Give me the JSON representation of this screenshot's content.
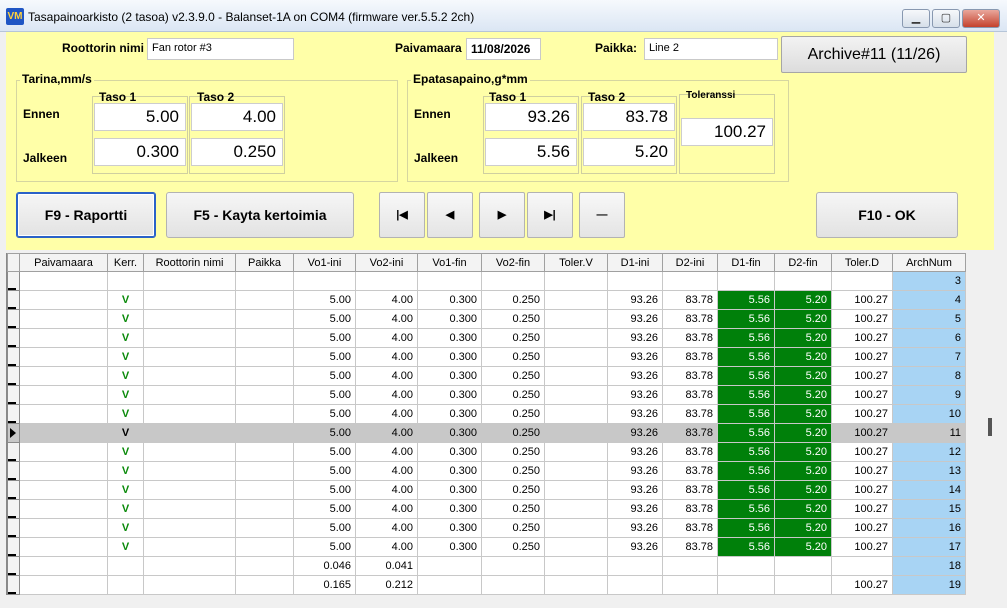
{
  "window": {
    "title": "Tasapainoarkisto (2 tasoa) v2.3.9.0 - Balanset-1A on COM4 (firmware ver.5.5.2 2ch)",
    "icon": "VM"
  },
  "header": {
    "rotor_label": "Roottorin nimi",
    "rotor_value": "Fan rotor #3",
    "date_label": "Paivamaara",
    "date_value": "11/08/2026",
    "place_label": "Paikka:",
    "place_value": "Line 2",
    "archive_button": "Archive#11 (11/26)"
  },
  "vibration": {
    "title": "Tarina,mm/s",
    "taso1": "Taso 1",
    "taso2": "Taso 2",
    "ennen": "Ennen",
    "jalkeen": "Jalkeen",
    "ennen_t1": "5.00",
    "ennen_t2": "4.00",
    "jalkeen_t1": "0.300",
    "jalkeen_t2": "0.250"
  },
  "imbalance": {
    "title": "Epatasapaino,g*mm",
    "taso1": "Taso 1",
    "taso2": "Taso 2",
    "toleranssi": "Toleranssi",
    "ennen": "Ennen",
    "jalkeen": "Jalkeen",
    "ennen_t1": "93.26",
    "ennen_t2": "83.78",
    "jalkeen_t1": "5.56",
    "jalkeen_t2": "5.20",
    "tolerance_value": "100.27"
  },
  "buttons": {
    "report": "F9 - Raportti",
    "coeffs": "F5 - Kayta kertoimia",
    "ok": "F10 - OK",
    "first": "|◀",
    "prev": "◀",
    "next": "▶",
    "last": "▶|",
    "delete": "—"
  },
  "grid": {
    "columns": [
      "Paivamaara",
      "Kerr.",
      "Roottorin nimi",
      "Paikka",
      "Vo1-ini",
      "Vo2-ini",
      "Vo1-fin",
      "Vo2-fin",
      "Toler.V",
      "D1-ini",
      "D2-ini",
      "D1-fin",
      "D2-fin",
      "Toler.D",
      "ArchNum"
    ],
    "rows": [
      {
        "kerr": "",
        "vo1i": "",
        "vo2i": "",
        "vo1f": "",
        "vo2f": "",
        "d1i": "",
        "d2i": "",
        "d1f": "",
        "d2f": "",
        "told": "",
        "arch": "3"
      },
      {
        "kerr": "V",
        "vo1i": "5.00",
        "vo2i": "4.00",
        "vo1f": "0.300",
        "vo2f": "0.250",
        "d1i": "93.26",
        "d2i": "83.78",
        "d1f": "5.56",
        "d2f": "5.20",
        "told": "100.27",
        "arch": "4"
      },
      {
        "kerr": "V",
        "vo1i": "5.00",
        "vo2i": "4.00",
        "vo1f": "0.300",
        "vo2f": "0.250",
        "d1i": "93.26",
        "d2i": "83.78",
        "d1f": "5.56",
        "d2f": "5.20",
        "told": "100.27",
        "arch": "5"
      },
      {
        "kerr": "V",
        "vo1i": "5.00",
        "vo2i": "4.00",
        "vo1f": "0.300",
        "vo2f": "0.250",
        "d1i": "93.26",
        "d2i": "83.78",
        "d1f": "5.56",
        "d2f": "5.20",
        "told": "100.27",
        "arch": "6"
      },
      {
        "kerr": "V",
        "vo1i": "5.00",
        "vo2i": "4.00",
        "vo1f": "0.300",
        "vo2f": "0.250",
        "d1i": "93.26",
        "d2i": "83.78",
        "d1f": "5.56",
        "d2f": "5.20",
        "told": "100.27",
        "arch": "7"
      },
      {
        "kerr": "V",
        "vo1i": "5.00",
        "vo2i": "4.00",
        "vo1f": "0.300",
        "vo2f": "0.250",
        "d1i": "93.26",
        "d2i": "83.78",
        "d1f": "5.56",
        "d2f": "5.20",
        "told": "100.27",
        "arch": "8"
      },
      {
        "kerr": "V",
        "vo1i": "5.00",
        "vo2i": "4.00",
        "vo1f": "0.300",
        "vo2f": "0.250",
        "d1i": "93.26",
        "d2i": "83.78",
        "d1f": "5.56",
        "d2f": "5.20",
        "told": "100.27",
        "arch": "9"
      },
      {
        "kerr": "V",
        "vo1i": "5.00",
        "vo2i": "4.00",
        "vo1f": "0.300",
        "vo2f": "0.250",
        "d1i": "93.26",
        "d2i": "83.78",
        "d1f": "5.56",
        "d2f": "5.20",
        "told": "100.27",
        "arch": "10"
      },
      {
        "kerr": "V",
        "vo1i": "5.00",
        "vo2i": "4.00",
        "vo1f": "0.300",
        "vo2f": "0.250",
        "d1i": "93.26",
        "d2i": "83.78",
        "d1f": "5.56",
        "d2f": "5.20",
        "told": "100.27",
        "arch": "11",
        "selected": true
      },
      {
        "kerr": "V",
        "vo1i": "5.00",
        "vo2i": "4.00",
        "vo1f": "0.300",
        "vo2f": "0.250",
        "d1i": "93.26",
        "d2i": "83.78",
        "d1f": "5.56",
        "d2f": "5.20",
        "told": "100.27",
        "arch": "12"
      },
      {
        "kerr": "V",
        "vo1i": "5.00",
        "vo2i": "4.00",
        "vo1f": "0.300",
        "vo2f": "0.250",
        "d1i": "93.26",
        "d2i": "83.78",
        "d1f": "5.56",
        "d2f": "5.20",
        "told": "100.27",
        "arch": "13"
      },
      {
        "kerr": "V",
        "vo1i": "5.00",
        "vo2i": "4.00",
        "vo1f": "0.300",
        "vo2f": "0.250",
        "d1i": "93.26",
        "d2i": "83.78",
        "d1f": "5.56",
        "d2f": "5.20",
        "told": "100.27",
        "arch": "14"
      },
      {
        "kerr": "V",
        "vo1i": "5.00",
        "vo2i": "4.00",
        "vo1f": "0.300",
        "vo2f": "0.250",
        "d1i": "93.26",
        "d2i": "83.78",
        "d1f": "5.56",
        "d2f": "5.20",
        "told": "100.27",
        "arch": "15"
      },
      {
        "kerr": "V",
        "vo1i": "5.00",
        "vo2i": "4.00",
        "vo1f": "0.300",
        "vo2f": "0.250",
        "d1i": "93.26",
        "d2i": "83.78",
        "d1f": "5.56",
        "d2f": "5.20",
        "told": "100.27",
        "arch": "16"
      },
      {
        "kerr": "V",
        "vo1i": "5.00",
        "vo2i": "4.00",
        "vo1f": "0.300",
        "vo2f": "0.250",
        "d1i": "93.26",
        "d2i": "83.78",
        "d1f": "5.56",
        "d2f": "5.20",
        "told": "100.27",
        "arch": "17"
      },
      {
        "kerr": "",
        "vo1i": "0.046",
        "vo2i": "0.041",
        "vo1f": "",
        "vo2f": "",
        "d1i": "",
        "d2i": "",
        "d1f": "",
        "d2f": "",
        "told": "",
        "arch": "18"
      },
      {
        "kerr": "",
        "vo1i": "0.165",
        "vo2i": "0.212",
        "vo1f": "",
        "vo2f": "",
        "d1i": "",
        "d2i": "",
        "d1f": "",
        "d2f": "",
        "told": "100.27",
        "arch": "19"
      }
    ]
  }
}
